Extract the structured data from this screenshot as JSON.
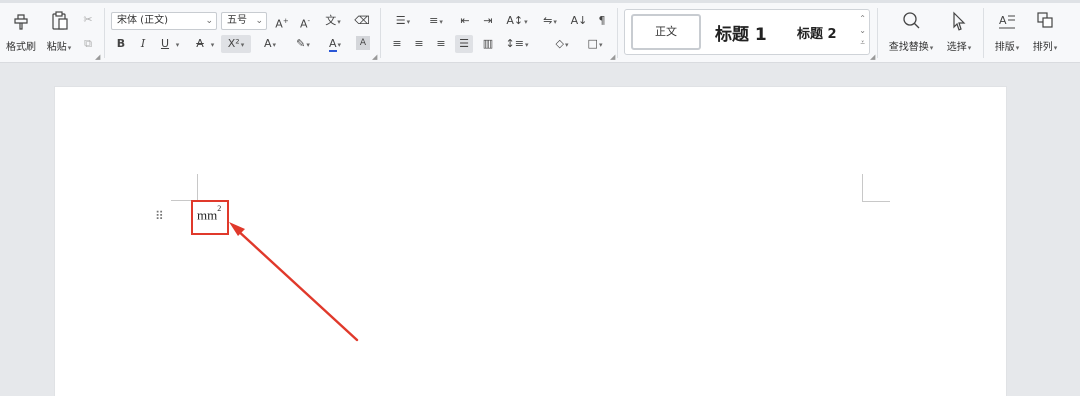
{
  "ribbon": {
    "clipboard": {
      "format_painter": "格式刷",
      "paste": "粘贴"
    },
    "font": {
      "name": "宋体 (正文)",
      "size": "五号",
      "bold": "B",
      "italic": "I",
      "underline": "U",
      "strike": "A",
      "superscript": "X²"
    },
    "paragraph": {
      "sort": "A↓"
    },
    "styles": {
      "normal": "正文",
      "heading1": "标题 1",
      "heading2": "标题 2"
    },
    "find_replace": "查找替换",
    "select": "选择",
    "layout": "排版",
    "arrange": "排列"
  },
  "document": {
    "content_base": "mm",
    "content_sup": "2"
  },
  "colors": {
    "annotation": "#e0392b",
    "font_color_bar": "#2b57d6"
  }
}
